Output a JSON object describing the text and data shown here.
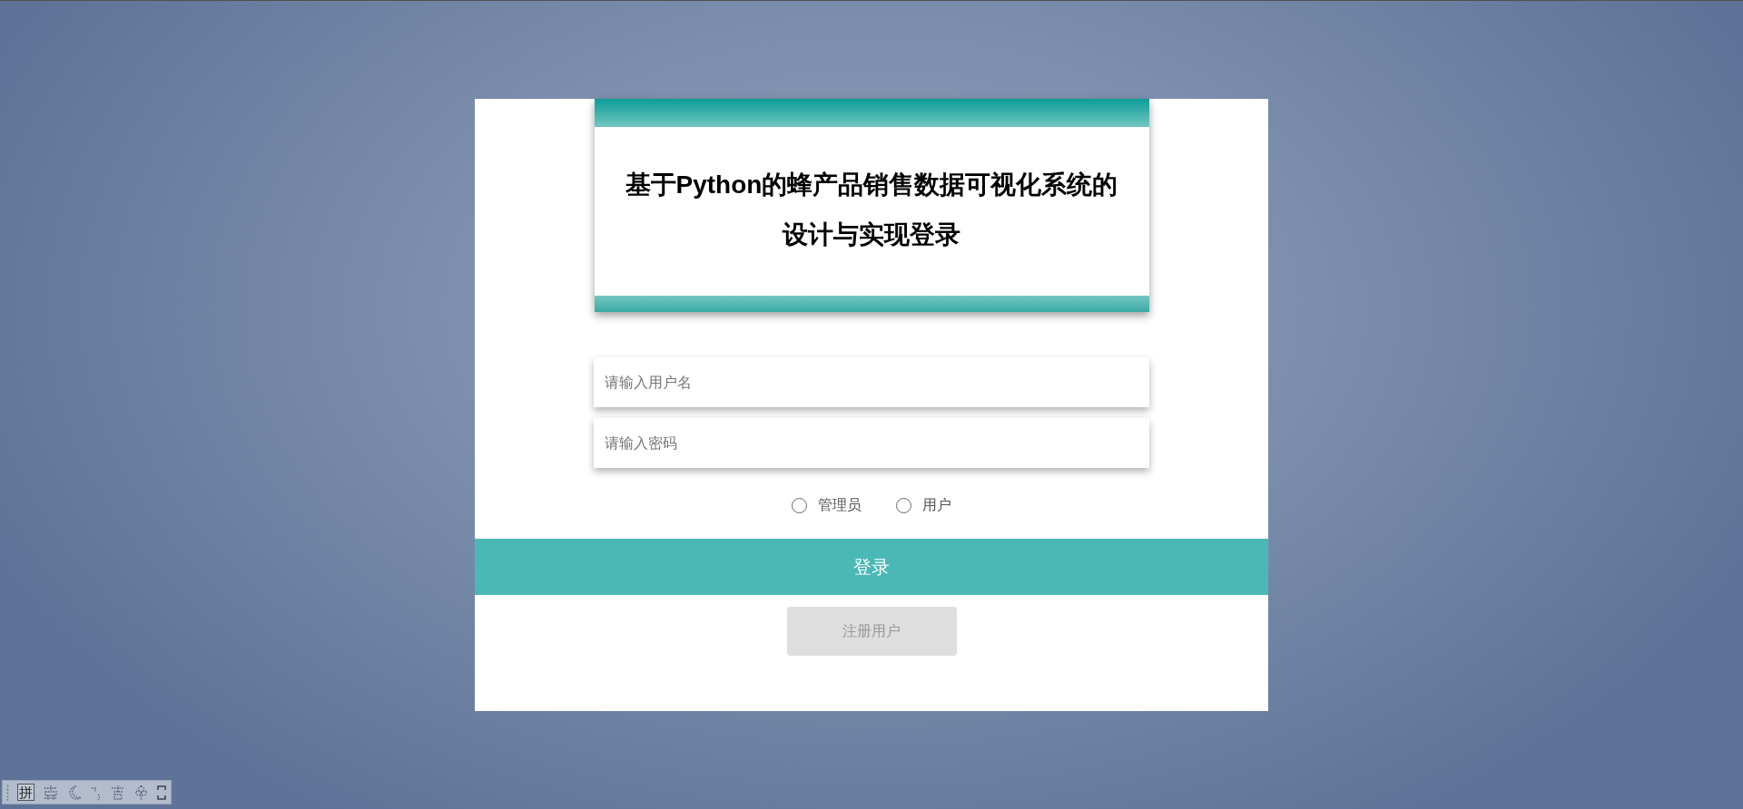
{
  "login_card": {
    "title": "基于Python的蜂产品销售数据可视化系统的设计与实现登录",
    "fields": [
      {
        "placeholder": "请输入用户名"
      },
      {
        "placeholder": "请输入密码"
      }
    ],
    "roles": [
      {
        "label": "管理员",
        "selected": false
      },
      {
        "label": "用户",
        "selected": false
      }
    ],
    "buttons": [
      {
        "kind": "primary",
        "label": "登录"
      },
      {
        "kind": "secondary",
        "label": "注册用户"
      }
    ]
  },
  "ime_toolbar": {
    "mode": "拼"
  }
}
